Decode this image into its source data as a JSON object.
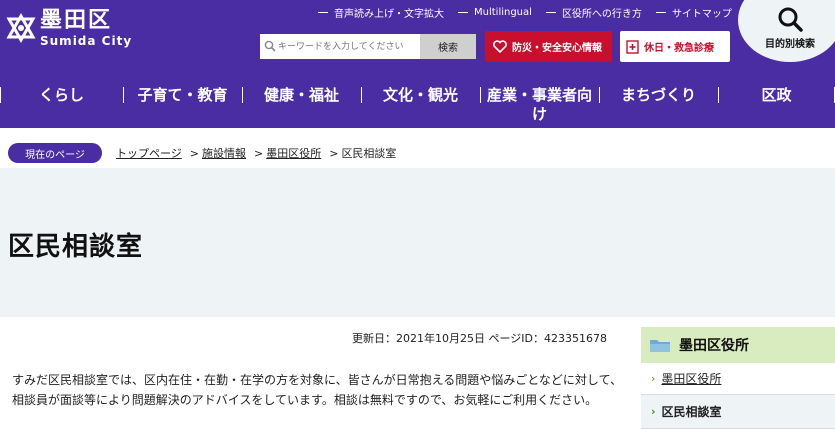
{
  "site": {
    "title": "墨田区",
    "subtitle": "Sumida City"
  },
  "utility_links": [
    "音声読み上げ・文字拡大",
    "Multilingual",
    "区役所への行き方",
    "サイトマップ"
  ],
  "search": {
    "placeholder": "キーワードを入力してください",
    "button": "検索"
  },
  "buttons": {
    "disaster": "防災・安全安心情報",
    "holiday": "休日・救急診療",
    "purpose_search": "目的別検索"
  },
  "nav": [
    "くらし",
    "子育て・教育",
    "健康・福祉",
    "文化・観光",
    "産業・事業者向け",
    "まちづくり",
    "区政"
  ],
  "breadcrumb": {
    "label": "現在のページ",
    "items": [
      "トップページ",
      "施設情報",
      "墨田区役所",
      "区民相談室"
    ],
    "separator": ">"
  },
  "page": {
    "title": "区民相談室",
    "updated_label": "更新日：2021年10月25日",
    "page_id_label": "ページID：423351678",
    "body": "すみだ区民相談室では、区内在住・在勤・在学の方を対象に、皆さんが日常抱える問題や悩みごとなどに対して、相談員が面談等により問題解決のアドバイスをしています。相談は無料ですので、お気軽にご利用ください。"
  },
  "side_menu": {
    "heading": "墨田区役所",
    "items": [
      "墨田区役所",
      "区民相談室"
    ]
  },
  "colors": {
    "brand_purple": "#4a2ca3",
    "alert_red": "#c8102e",
    "band_gray": "#eef3f6",
    "side_green": "#d9ecbf"
  }
}
